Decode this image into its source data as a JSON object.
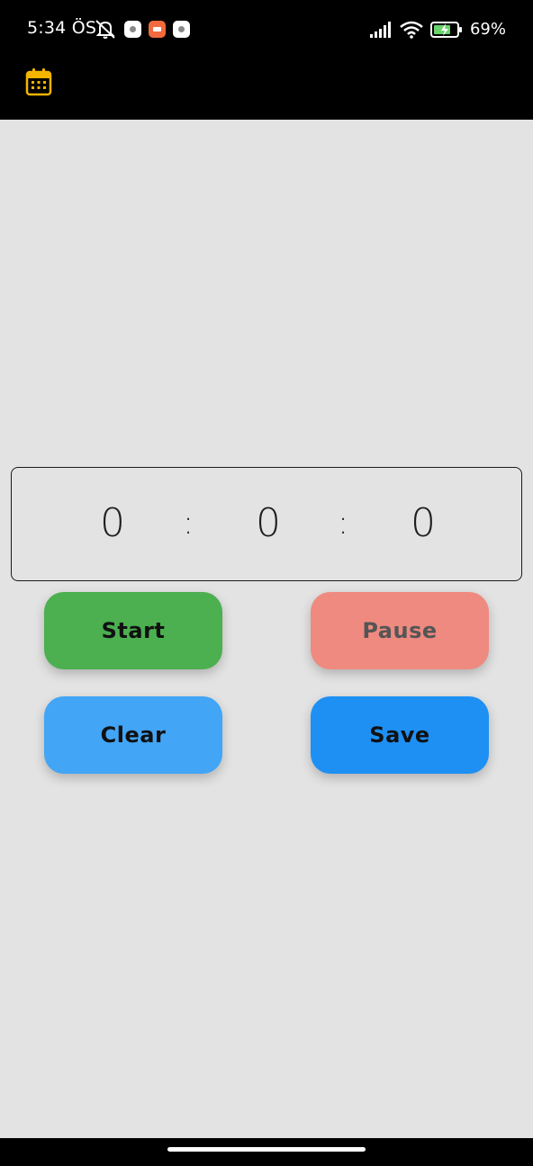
{
  "status_bar": {
    "time": "5:34 ÖS",
    "battery_percent": "69%",
    "icons": [
      "mute-icon",
      "notification-icon",
      "notification-icon",
      "notification-icon",
      "signal-icon",
      "wifi-icon",
      "battery-charging-icon"
    ]
  },
  "app_bar": {
    "icon": "calendar-icon",
    "icon_color": "#f5b400"
  },
  "timer": {
    "hours": "0",
    "separator_1": ":",
    "minutes": "0",
    "separator_2": ":",
    "seconds": "0"
  },
  "buttons": {
    "start": "Start",
    "pause": "Pause",
    "clear": "Clear",
    "save": "Save"
  },
  "colors": {
    "start": "#4caf50",
    "pause": "#ef8a80",
    "clear": "#42a5f5",
    "save": "#1e90f4",
    "background": "#e3e3e3"
  }
}
